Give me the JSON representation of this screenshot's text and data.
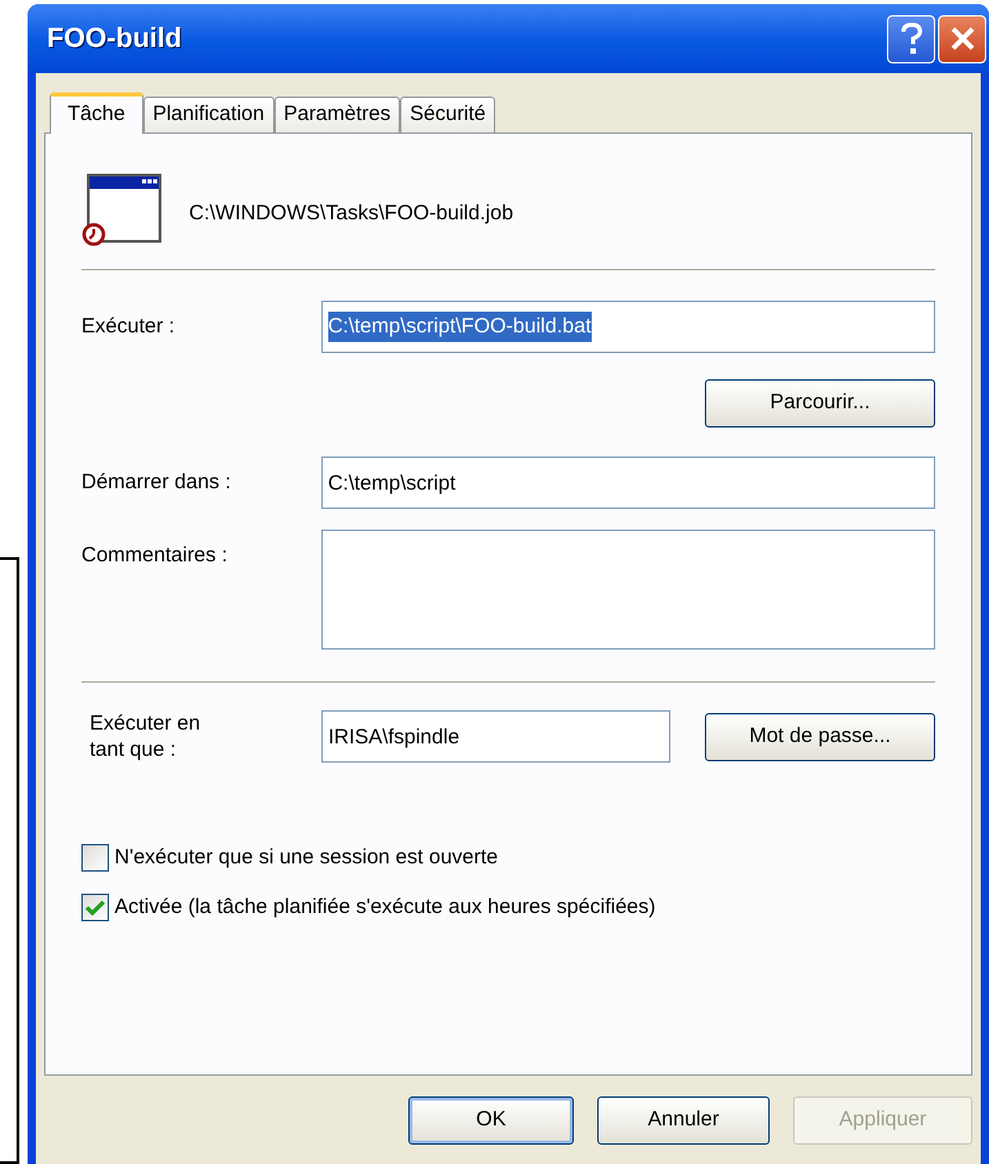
{
  "window": {
    "title": "FOO-build"
  },
  "tabs": [
    {
      "label": "Tâche",
      "selected": true
    },
    {
      "label": "Planification",
      "selected": false
    },
    {
      "label": "Paramètres",
      "selected": false
    },
    {
      "label": "Sécurité",
      "selected": false
    }
  ],
  "task_path": "C:\\WINDOWS\\Tasks\\FOO-build.job",
  "run": {
    "label": "Exécuter :",
    "value": "C:\\temp\\script\\FOO-build.bat",
    "value_selected": true
  },
  "browse_button": "Parcourir...",
  "start_in": {
    "label": "Démarrer dans :",
    "value": "C:\\temp\\script"
  },
  "comments": {
    "label": "Commentaires :"
  },
  "run_as": {
    "label_lines": [
      "Exécuter en",
      "tant que :"
    ],
    "value": "IRISA\\fspindle"
  },
  "password_button": "Mot de passe...",
  "checkboxes": [
    {
      "label": "N'exécuter que si une session est ouverte",
      "checked": false
    },
    {
      "label": "Activée (la tâche planifiée s'exécute aux heures spécifiées)",
      "checked": true
    }
  ],
  "buttons": [
    {
      "label": "OK",
      "disabled": false,
      "default": true
    },
    {
      "label": "Annuler",
      "disabled": false,
      "default": false
    },
    {
      "label": "Appliquer",
      "disabled": true,
      "default": false
    }
  ]
}
